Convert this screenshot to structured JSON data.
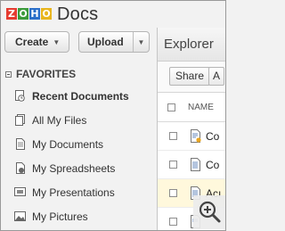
{
  "header": {
    "logo_letters": [
      "Z",
      "O",
      "H",
      "O"
    ],
    "app_name": "Docs"
  },
  "buttons": {
    "create": "Create",
    "upload": "Upload"
  },
  "sidebar": {
    "section": "FAVORITES",
    "items": [
      {
        "label": "Recent Documents",
        "icon": "recent-documents-icon"
      },
      {
        "label": "All My Files",
        "icon": "all-files-icon"
      },
      {
        "label": "My Documents",
        "icon": "document-icon"
      },
      {
        "label": "My Spreadsheets",
        "icon": "spreadsheet-icon"
      },
      {
        "label": "My Presentations",
        "icon": "presentation-icon"
      },
      {
        "label": "My Pictures",
        "icon": "picture-icon"
      }
    ]
  },
  "explorer": {
    "title": "Explorer",
    "toolbar": {
      "share": "Share",
      "second": "A"
    },
    "column_name": "NAME",
    "rows": [
      {
        "name": "Co",
        "type": "document",
        "highlighted": false
      },
      {
        "name": "Co",
        "type": "document",
        "highlighted": false
      },
      {
        "name": "Acı",
        "type": "document",
        "highlighted": true
      },
      {
        "name": "",
        "type": "document",
        "highlighted": false
      }
    ]
  },
  "overlay": {
    "icon": "zoom-in-icon"
  },
  "colors": {
    "zoho_z": "#e53a2f",
    "zoho_o1": "#3a9a3a",
    "zoho_h": "#2b6fc9",
    "zoho_o2": "#e8b51d",
    "highlight_row": "#fff8dc"
  }
}
